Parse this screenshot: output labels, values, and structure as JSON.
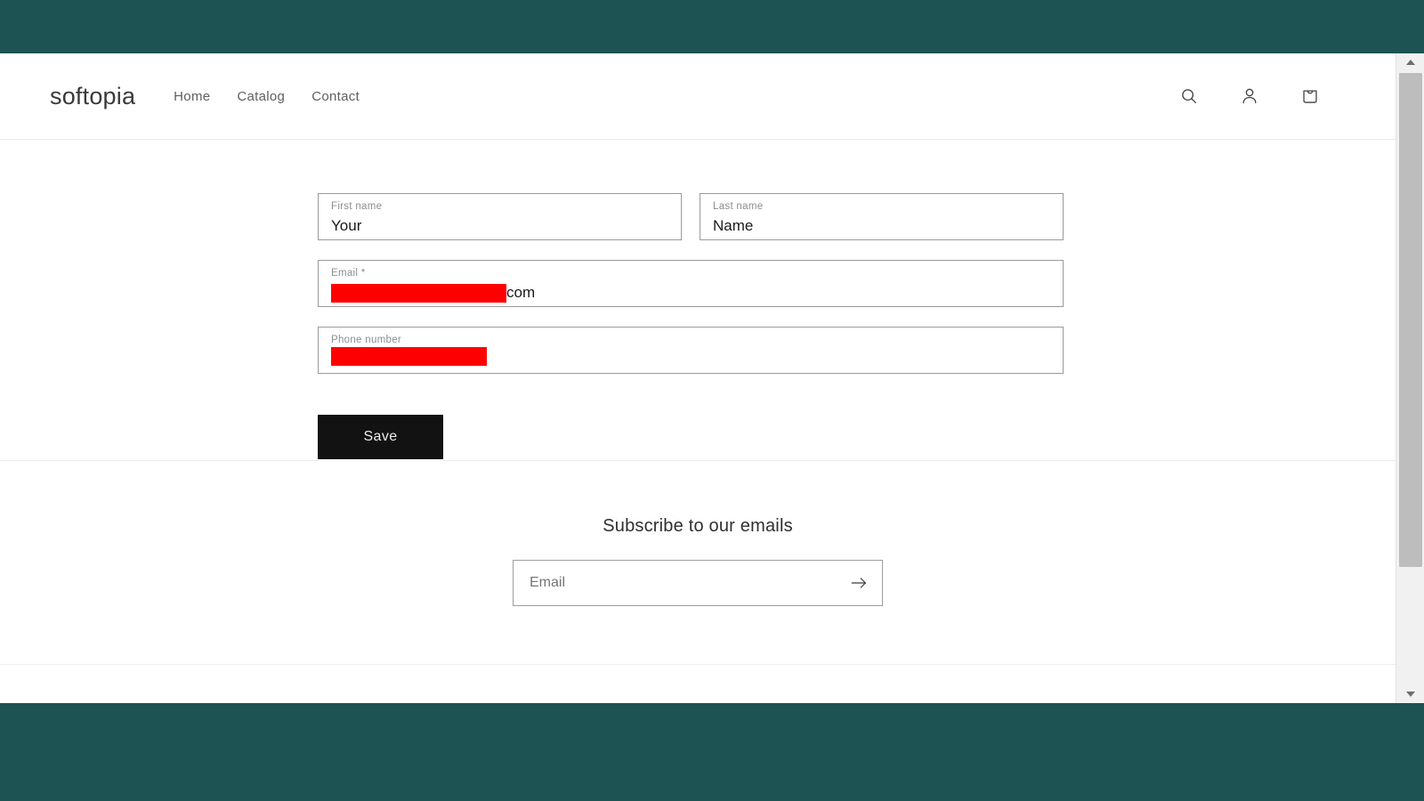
{
  "theme": {
    "band_color": "#1d5352",
    "redaction_color": "#ff0000",
    "button_color": "#121212"
  },
  "header": {
    "brand": "softopia",
    "nav": [
      {
        "label": "Home"
      },
      {
        "label": "Catalog"
      },
      {
        "label": "Contact"
      }
    ],
    "actions": [
      {
        "icon": "search-icon"
      },
      {
        "icon": "account-icon"
      },
      {
        "icon": "cart-icon"
      }
    ]
  },
  "account_form": {
    "first_name": {
      "label": "First name",
      "value": "Your"
    },
    "last_name": {
      "label": "Last name",
      "value": "Name"
    },
    "email": {
      "label": "Email *",
      "value_suffix": "com",
      "redacted": true
    },
    "phone": {
      "label": "Phone number",
      "value": "",
      "redacted": true
    },
    "save_label": "Save"
  },
  "newsletter": {
    "title": "Subscribe to our emails",
    "placeholder": "Email",
    "value": "",
    "submit_icon": "arrow-right-icon"
  }
}
